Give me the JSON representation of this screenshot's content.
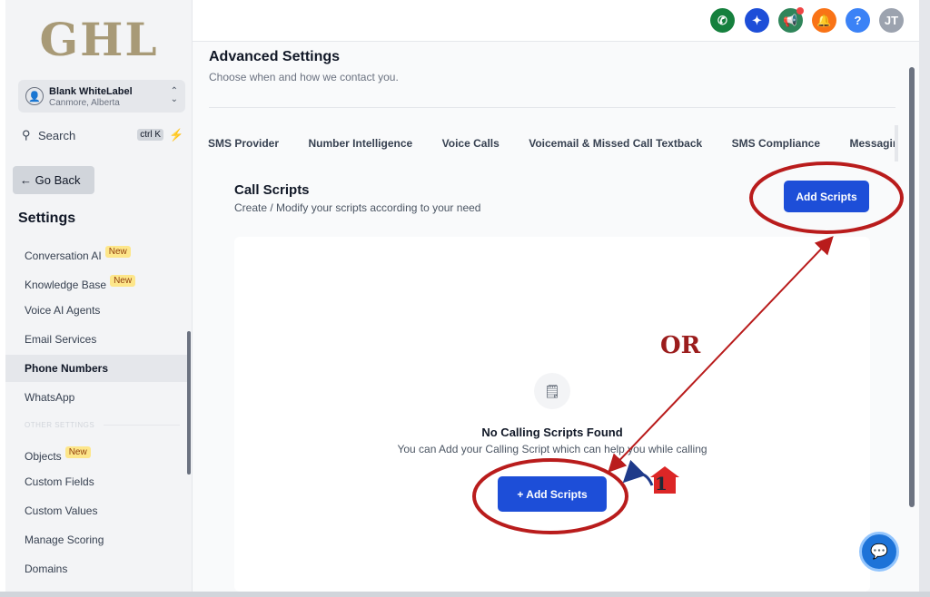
{
  "logo": "GHL",
  "account": {
    "name": "Blank WhiteLabel",
    "location": "Canmore, Alberta"
  },
  "search": {
    "placeholder": "Search",
    "shortcut": "ctrl K"
  },
  "go_back": "← Go Back",
  "settings_title": "Settings",
  "new_badge": "New",
  "sidebar": {
    "items": [
      {
        "label": "Conversation AI",
        "new": true
      },
      {
        "label": "Knowledge Base",
        "new": true
      },
      {
        "label": "Voice AI Agents"
      },
      {
        "label": "Email Services"
      },
      {
        "label": "Phone Numbers",
        "active": true
      },
      {
        "label": "WhatsApp"
      }
    ],
    "other_label": "OTHER SETTINGS",
    "other_items": [
      {
        "label": "Objects",
        "new": true
      },
      {
        "label": "Custom Fields"
      },
      {
        "label": "Custom Values"
      },
      {
        "label": "Manage Scoring"
      },
      {
        "label": "Domains"
      }
    ]
  },
  "topbar": {
    "buttons": [
      {
        "icon": "phone-icon",
        "color": "#15803d"
      },
      {
        "icon": "magic-icon",
        "color": "#1d4ed8"
      },
      {
        "icon": "megaphone-icon",
        "color": "#2f855a"
      },
      {
        "icon": "bell-icon",
        "color": "#f97316"
      },
      {
        "icon": "help-icon",
        "color": "#3b82f6",
        "label": "?"
      },
      {
        "icon": "user-avatar",
        "color": "#9ca3af",
        "label": "JT"
      }
    ]
  },
  "main": {
    "title": "Advanced Settings",
    "subtitle": "Choose when and how we contact you.",
    "tabs": [
      "SMS Provider",
      "Number Intelligence",
      "Voice Calls",
      "Voicemail & Missed Call Textback",
      "SMS Compliance",
      "Messaging"
    ],
    "section_title": "Call Scripts",
    "section_subtitle": "Create / Modify your scripts according to your need",
    "add_button": "Add Scripts",
    "empty_title": "No Calling Scripts Found",
    "empty_subtitle": "You can Add your Calling Script which can help you while calling",
    "add_button_center": "+ Add Scripts"
  },
  "annotations": {
    "or_text": "OR",
    "step_number": "1",
    "color": "#b91c1c"
  }
}
